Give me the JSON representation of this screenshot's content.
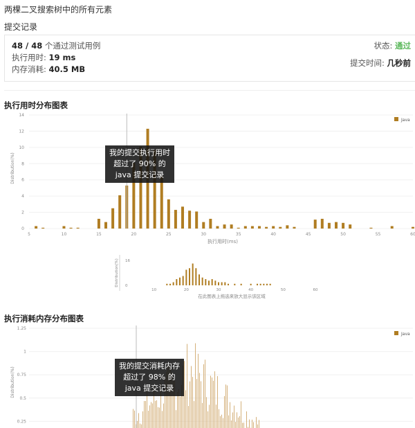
{
  "page": {
    "title": "两棵二叉搜索树中的所有元素",
    "section": "提交记录"
  },
  "submission": {
    "passed": "48 / 48",
    "passed_suffix": "个通过测试用例",
    "runtime_label": "执行用时:",
    "runtime_value": "19 ms",
    "memory_label": "内存消耗:",
    "memory_value": "40.5 MB",
    "status_label": "状态:",
    "status_value": "通过",
    "time_label": "提交时间:",
    "time_value": "几秒前",
    "status_color": "#5cb85c"
  },
  "runtime_chart": {
    "title": "执行用时分布图表",
    "legend": "Java",
    "tooltip": [
      "我的提交执行用时",
      "超过了 90% 的",
      "java 提交记录"
    ],
    "brush_label": "在此图表上拖选来放大显示该区域"
  },
  "memory_chart": {
    "title": "执行消耗内存分布图表",
    "legend": "Java",
    "tooltip": [
      "我的提交消耗内存",
      "超过了 98% 的",
      "java 提交记录"
    ]
  },
  "bar_color": "#b07d22",
  "chart_data": [
    {
      "type": "bar",
      "xlabel": "执行用时(ms)",
      "ylabel": "Distribution(%)",
      "ylim": [
        0,
        14
      ],
      "yticks": [
        0,
        2,
        4,
        6,
        8,
        10,
        12,
        14
      ],
      "xticks": [
        5,
        10,
        15,
        20,
        25,
        30,
        35,
        40,
        45,
        50,
        55,
        60
      ],
      "xlim": [
        5,
        60
      ],
      "marker_x": 19,
      "series": [
        {
          "name": "Java",
          "x": [
            6,
            7,
            10,
            11,
            12,
            15,
            16,
            17,
            18,
            19,
            20,
            21,
            22,
            23,
            24,
            25,
            26,
            27,
            28,
            29,
            30,
            31,
            32,
            33,
            34,
            35,
            36,
            37,
            38,
            39,
            40,
            41,
            42,
            43,
            46,
            47,
            48,
            49,
            50,
            51,
            54,
            57,
            60
          ],
          "values": [
            0.3,
            0.1,
            0.3,
            0.1,
            0.1,
            1.2,
            0.8,
            2.5,
            4.1,
            5.3,
            8.1,
            10.1,
            12.3,
            9.7,
            6.5,
            3.6,
            2.3,
            2.7,
            2.2,
            2.1,
            0.8,
            1.2,
            0.3,
            0.5,
            0.5,
            0.1,
            0.3,
            0.3,
            0.3,
            0.2,
            0.3,
            0.2,
            0.4,
            0.2,
            1.1,
            1.2,
            0.7,
            0.8,
            0.7,
            0.5,
            0.1,
            0.3,
            0.2
          ]
        }
      ]
    },
    {
      "type": "bar",
      "ylabel": "Distribution(%)",
      "ylim": [
        0,
        16
      ],
      "yticks": [
        0,
        16
      ],
      "xticks": [
        10,
        20,
        30,
        40,
        50,
        60
      ],
      "xlim": [
        0,
        60
      ],
      "series": [
        {
          "name": "Java",
          "x": [
            14,
            15,
            16,
            17,
            18,
            19,
            20,
            21,
            22,
            23,
            24,
            25,
            26,
            27,
            28,
            29,
            30,
            31,
            32,
            33,
            35,
            37,
            40,
            42,
            43,
            44,
            45,
            46
          ],
          "values": [
            1,
            1,
            2,
            4,
            5,
            6,
            10,
            11,
            14,
            11,
            7,
            5,
            4,
            3,
            4,
            3,
            2,
            2,
            2,
            1,
            1,
            1,
            1,
            1,
            1,
            1,
            1,
            1
          ]
        }
      ]
    },
    {
      "type": "bar",
      "ylabel": "Distribution(%)",
      "ylim": [
        0,
        1.25
      ],
      "yticks": [
        0.25,
        0.5,
        0.75,
        1,
        1.25
      ]
    }
  ]
}
